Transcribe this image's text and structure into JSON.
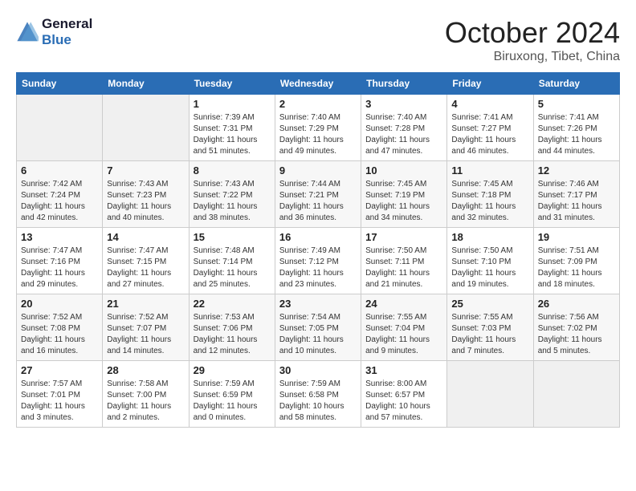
{
  "header": {
    "logo_line1": "General",
    "logo_line2": "Blue",
    "month": "October 2024",
    "location": "Biruxong, Tibet, China"
  },
  "weekdays": [
    "Sunday",
    "Monday",
    "Tuesday",
    "Wednesday",
    "Thursday",
    "Friday",
    "Saturday"
  ],
  "weeks": [
    [
      {
        "day": "",
        "sunrise": "",
        "sunset": "",
        "daylight": ""
      },
      {
        "day": "",
        "sunrise": "",
        "sunset": "",
        "daylight": ""
      },
      {
        "day": "1",
        "sunrise": "Sunrise: 7:39 AM",
        "sunset": "Sunset: 7:31 PM",
        "daylight": "Daylight: 11 hours and 51 minutes."
      },
      {
        "day": "2",
        "sunrise": "Sunrise: 7:40 AM",
        "sunset": "Sunset: 7:29 PM",
        "daylight": "Daylight: 11 hours and 49 minutes."
      },
      {
        "day": "3",
        "sunrise": "Sunrise: 7:40 AM",
        "sunset": "Sunset: 7:28 PM",
        "daylight": "Daylight: 11 hours and 47 minutes."
      },
      {
        "day": "4",
        "sunrise": "Sunrise: 7:41 AM",
        "sunset": "Sunset: 7:27 PM",
        "daylight": "Daylight: 11 hours and 46 minutes."
      },
      {
        "day": "5",
        "sunrise": "Sunrise: 7:41 AM",
        "sunset": "Sunset: 7:26 PM",
        "daylight": "Daylight: 11 hours and 44 minutes."
      }
    ],
    [
      {
        "day": "6",
        "sunrise": "Sunrise: 7:42 AM",
        "sunset": "Sunset: 7:24 PM",
        "daylight": "Daylight: 11 hours and 42 minutes."
      },
      {
        "day": "7",
        "sunrise": "Sunrise: 7:43 AM",
        "sunset": "Sunset: 7:23 PM",
        "daylight": "Daylight: 11 hours and 40 minutes."
      },
      {
        "day": "8",
        "sunrise": "Sunrise: 7:43 AM",
        "sunset": "Sunset: 7:22 PM",
        "daylight": "Daylight: 11 hours and 38 minutes."
      },
      {
        "day": "9",
        "sunrise": "Sunrise: 7:44 AM",
        "sunset": "Sunset: 7:21 PM",
        "daylight": "Daylight: 11 hours and 36 minutes."
      },
      {
        "day": "10",
        "sunrise": "Sunrise: 7:45 AM",
        "sunset": "Sunset: 7:19 PM",
        "daylight": "Daylight: 11 hours and 34 minutes."
      },
      {
        "day": "11",
        "sunrise": "Sunrise: 7:45 AM",
        "sunset": "Sunset: 7:18 PM",
        "daylight": "Daylight: 11 hours and 32 minutes."
      },
      {
        "day": "12",
        "sunrise": "Sunrise: 7:46 AM",
        "sunset": "Sunset: 7:17 PM",
        "daylight": "Daylight: 11 hours and 31 minutes."
      }
    ],
    [
      {
        "day": "13",
        "sunrise": "Sunrise: 7:47 AM",
        "sunset": "Sunset: 7:16 PM",
        "daylight": "Daylight: 11 hours and 29 minutes."
      },
      {
        "day": "14",
        "sunrise": "Sunrise: 7:47 AM",
        "sunset": "Sunset: 7:15 PM",
        "daylight": "Daylight: 11 hours and 27 minutes."
      },
      {
        "day": "15",
        "sunrise": "Sunrise: 7:48 AM",
        "sunset": "Sunset: 7:14 PM",
        "daylight": "Daylight: 11 hours and 25 minutes."
      },
      {
        "day": "16",
        "sunrise": "Sunrise: 7:49 AM",
        "sunset": "Sunset: 7:12 PM",
        "daylight": "Daylight: 11 hours and 23 minutes."
      },
      {
        "day": "17",
        "sunrise": "Sunrise: 7:50 AM",
        "sunset": "Sunset: 7:11 PM",
        "daylight": "Daylight: 11 hours and 21 minutes."
      },
      {
        "day": "18",
        "sunrise": "Sunrise: 7:50 AM",
        "sunset": "Sunset: 7:10 PM",
        "daylight": "Daylight: 11 hours and 19 minutes."
      },
      {
        "day": "19",
        "sunrise": "Sunrise: 7:51 AM",
        "sunset": "Sunset: 7:09 PM",
        "daylight": "Daylight: 11 hours and 18 minutes."
      }
    ],
    [
      {
        "day": "20",
        "sunrise": "Sunrise: 7:52 AM",
        "sunset": "Sunset: 7:08 PM",
        "daylight": "Daylight: 11 hours and 16 minutes."
      },
      {
        "day": "21",
        "sunrise": "Sunrise: 7:52 AM",
        "sunset": "Sunset: 7:07 PM",
        "daylight": "Daylight: 11 hours and 14 minutes."
      },
      {
        "day": "22",
        "sunrise": "Sunrise: 7:53 AM",
        "sunset": "Sunset: 7:06 PM",
        "daylight": "Daylight: 11 hours and 12 minutes."
      },
      {
        "day": "23",
        "sunrise": "Sunrise: 7:54 AM",
        "sunset": "Sunset: 7:05 PM",
        "daylight": "Daylight: 11 hours and 10 minutes."
      },
      {
        "day": "24",
        "sunrise": "Sunrise: 7:55 AM",
        "sunset": "Sunset: 7:04 PM",
        "daylight": "Daylight: 11 hours and 9 minutes."
      },
      {
        "day": "25",
        "sunrise": "Sunrise: 7:55 AM",
        "sunset": "Sunset: 7:03 PM",
        "daylight": "Daylight: 11 hours and 7 minutes."
      },
      {
        "day": "26",
        "sunrise": "Sunrise: 7:56 AM",
        "sunset": "Sunset: 7:02 PM",
        "daylight": "Daylight: 11 hours and 5 minutes."
      }
    ],
    [
      {
        "day": "27",
        "sunrise": "Sunrise: 7:57 AM",
        "sunset": "Sunset: 7:01 PM",
        "daylight": "Daylight: 11 hours and 3 minutes."
      },
      {
        "day": "28",
        "sunrise": "Sunrise: 7:58 AM",
        "sunset": "Sunset: 7:00 PM",
        "daylight": "Daylight: 11 hours and 2 minutes."
      },
      {
        "day": "29",
        "sunrise": "Sunrise: 7:59 AM",
        "sunset": "Sunset: 6:59 PM",
        "daylight": "Daylight: 11 hours and 0 minutes."
      },
      {
        "day": "30",
        "sunrise": "Sunrise: 7:59 AM",
        "sunset": "Sunset: 6:58 PM",
        "daylight": "Daylight: 10 hours and 58 minutes."
      },
      {
        "day": "31",
        "sunrise": "Sunrise: 8:00 AM",
        "sunset": "Sunset: 6:57 PM",
        "daylight": "Daylight: 10 hours and 57 minutes."
      },
      {
        "day": "",
        "sunrise": "",
        "sunset": "",
        "daylight": ""
      },
      {
        "day": "",
        "sunrise": "",
        "sunset": "",
        "daylight": ""
      }
    ]
  ]
}
